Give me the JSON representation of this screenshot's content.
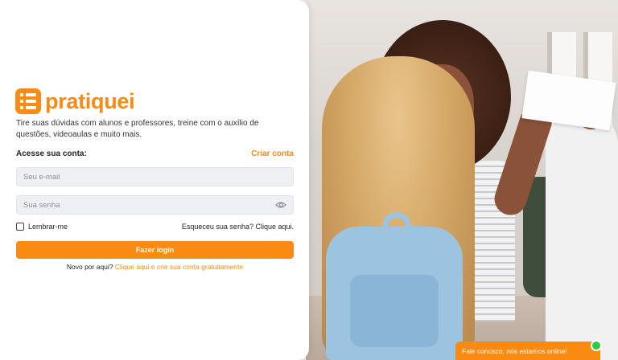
{
  "brand": {
    "name": "pratiquei",
    "color": "#f98a12",
    "logo_icon": "list-icon"
  },
  "tagline": "Tire suas dúvidas com alunos e professores, treine com o auxílio de questões, videoaulas e muito mais.",
  "login": {
    "access_label": "Acesse sua conta:",
    "create_account": "Criar conta",
    "email_placeholder": "Seu e-mail",
    "password_placeholder": "Sua senha",
    "password_toggle_icon": "eye-icon",
    "remember_label": "Lembrar-me",
    "forgot_label": "Esqueceu sua senha? Clique aqui.",
    "submit_label": "Fazer login",
    "signup_prefix": "Novo por aqui?",
    "signup_link": "Clique aqui e crie sua conta gratuitamente"
  },
  "chat": {
    "label": "Fale conosco, nós estamos online!",
    "status_color": "#2ecc40"
  }
}
